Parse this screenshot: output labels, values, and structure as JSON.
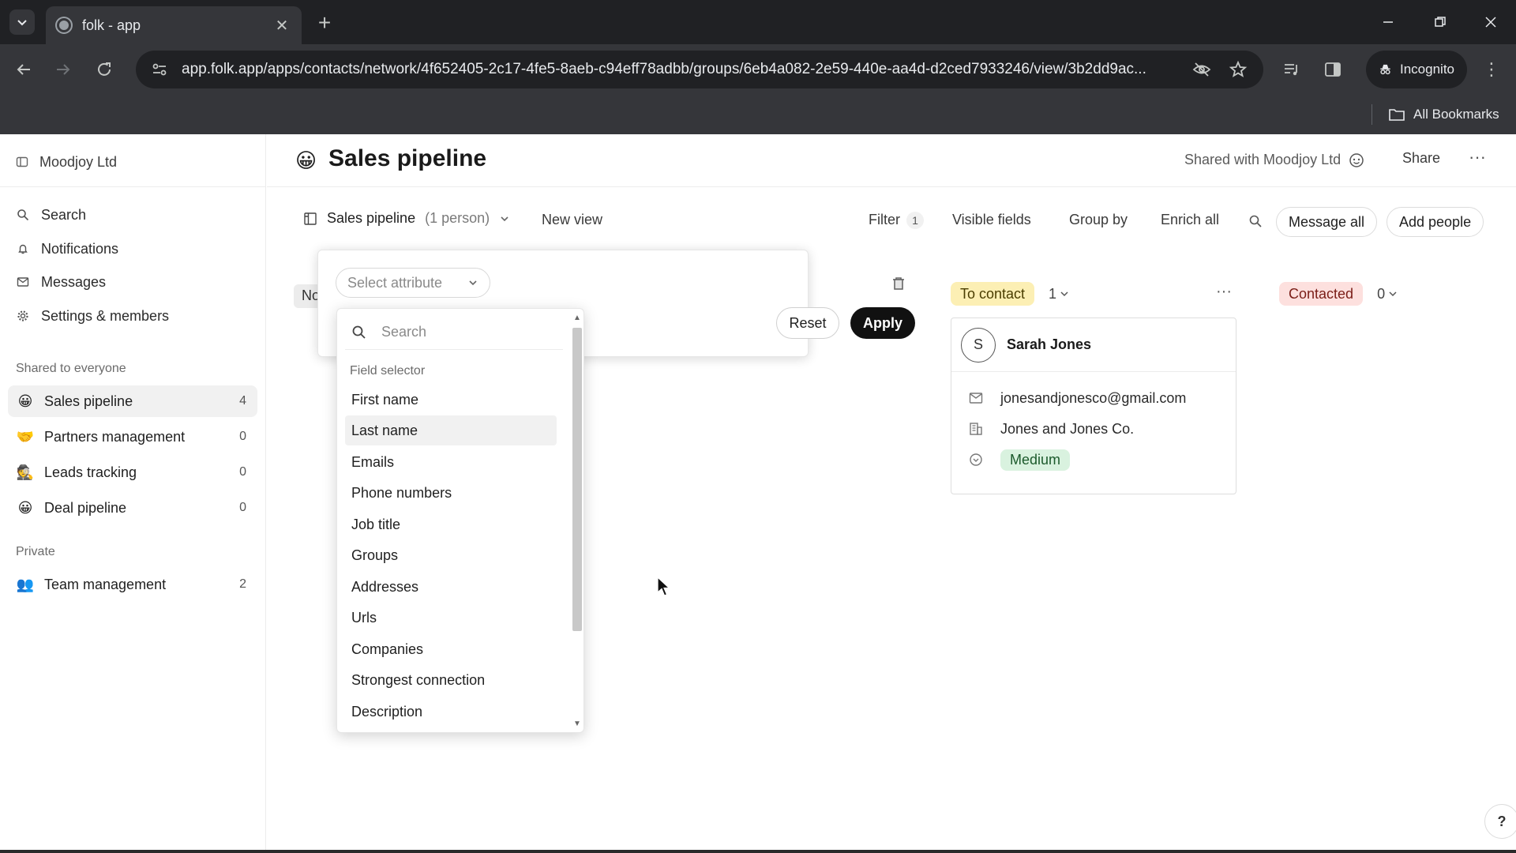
{
  "browser": {
    "tab_title": "folk - app",
    "url": "app.folk.app/apps/contacts/network/4f652405-2c17-4fe5-8aeb-c94eff78adbb/groups/6eb4a082-2e59-440e-aa4d-d2ced7933246/view/3b2dd9ac...",
    "incognito_label": "Incognito",
    "bookmarks_label": "All Bookmarks"
  },
  "sidebar": {
    "workspace": "Moodjoy Ltd",
    "nav": [
      {
        "label": "Search",
        "icon": "search-icon"
      },
      {
        "label": "Notifications",
        "icon": "bell-icon"
      },
      {
        "label": "Messages",
        "icon": "mail-icon"
      },
      {
        "label": "Settings & members",
        "icon": "gear-icon"
      }
    ],
    "shared_section": "Shared to everyone",
    "shared_groups": [
      {
        "emoji": "😀",
        "label": "Sales pipeline",
        "count": "4"
      },
      {
        "emoji": "🤝",
        "label": "Partners management",
        "count": "0"
      },
      {
        "emoji": "🕵",
        "label": "Leads tracking",
        "count": "0"
      },
      {
        "emoji": "😀",
        "label": "Deal pipeline",
        "count": "0"
      }
    ],
    "private_section": "Private",
    "private_groups": [
      {
        "emoji": "👥",
        "label": "Team management",
        "count": "2"
      }
    ]
  },
  "header": {
    "emoji": "😀",
    "title": "Sales pipeline",
    "shared_with": "Shared with Moodjoy Ltd",
    "share": "Share",
    "more": "···"
  },
  "view_bar": {
    "view_name": "Sales pipeline",
    "view_count": "(1 person)",
    "new_view": "New view",
    "filter": "Filter",
    "filter_count": "1",
    "visible_fields": "Visible fields",
    "group_by": "Group by",
    "enrich_all": "Enrich all",
    "message_all": "Message all",
    "add_people": "Add people"
  },
  "board": {
    "partial_column": "No",
    "columns": [
      {
        "label": "To contact",
        "count": "1",
        "color": "#fcefb4"
      },
      {
        "label": "Contacted",
        "count": "0",
        "color": "#fde0de"
      }
    ],
    "card": {
      "initial": "S",
      "name": "Sarah Jones",
      "email": "jonesandjonesco@gmail.com",
      "company": "Jones and Jones Co.",
      "priority": "Medium"
    }
  },
  "filter_popover": {
    "select_placeholder": "Select attribute",
    "reset": "Reset",
    "apply": "Apply"
  },
  "attribute_dropdown": {
    "search_placeholder": "Search",
    "section": "Field selector",
    "items": [
      "First name",
      "Last name",
      "Emails",
      "Phone numbers",
      "Job title",
      "Groups",
      "Addresses",
      "Urls",
      "Companies",
      "Strongest connection",
      "Description"
    ],
    "hovered": "Last name"
  },
  "help": "?"
}
